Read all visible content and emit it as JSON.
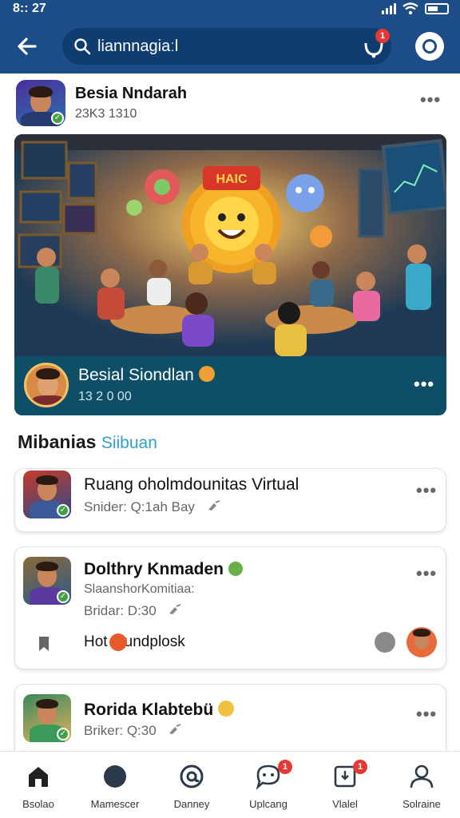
{
  "status_bar": {
    "time": "8:: 27"
  },
  "appbar": {
    "search_text": "liannnagiaːl",
    "notif_badge": "1"
  },
  "post": {
    "author_name": "Besia Nndarah",
    "author_sub": "23K3 1310",
    "menu": "•••"
  },
  "hero": {
    "sign_text": "HAIC",
    "footer_name": "Besial Siondlan",
    "footer_sub": "13 2 0 00",
    "menu": "•••"
  },
  "section": {
    "title": "Mibanias",
    "accent": "Siibuan"
  },
  "cards": [
    {
      "title": "Ruang oholmdounitas Virtual",
      "sub": "Snider: Q:1ah Bay",
      "menu": "•••"
    },
    {
      "title": "Dolthry Knmaden",
      "line2": "SlaanshorKomitiaa:",
      "sub": "Bridar: D:30",
      "footer_text": "Hot Mundplosk",
      "menu": "•••"
    },
    {
      "title": "Rorida Klabtebü",
      "sub": "Briker: Q:30",
      "menu": "•••"
    }
  ],
  "bottom_nav": [
    {
      "label": "Bsolao",
      "icon": "home-icon"
    },
    {
      "label": "Mamescer",
      "icon": "compass-icon"
    },
    {
      "label": "Danney",
      "icon": "at-icon"
    },
    {
      "label": "Uplcang",
      "icon": "chat-icon",
      "badge": "1"
    },
    {
      "label": "Vlalel",
      "icon": "inbox-icon",
      "badge": "1"
    },
    {
      "label": "Solraine",
      "icon": "profile-icon"
    }
  ],
  "colors": {
    "header": "#1d4d86",
    "accent": "#2f9ed1",
    "hero_footer": "#0e4e66",
    "badge": "#e53935"
  }
}
